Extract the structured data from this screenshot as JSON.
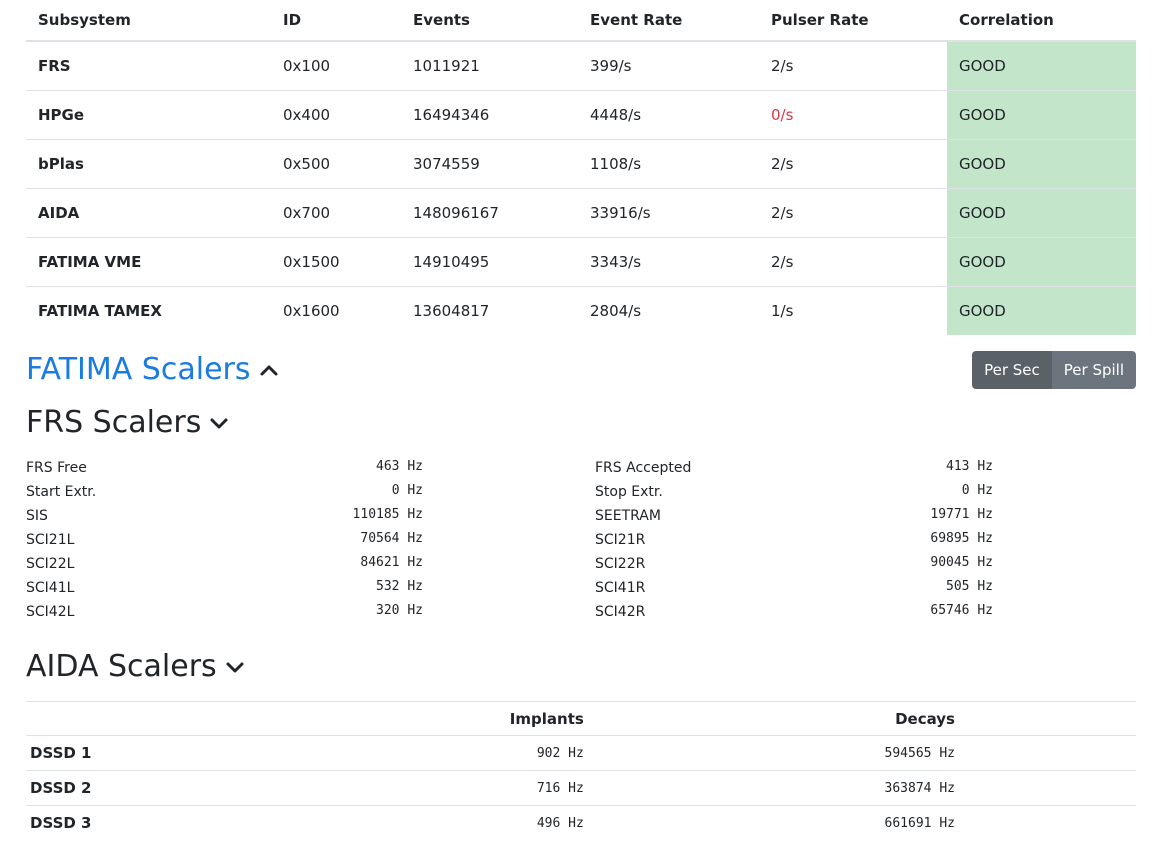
{
  "subsystems_table": {
    "headers": [
      "Subsystem",
      "ID",
      "Events",
      "Event Rate",
      "Pulser Rate",
      "Correlation"
    ],
    "rows": [
      {
        "name": "FRS",
        "id": "0x100",
        "events": "1011921",
        "event_rate": "399/s",
        "pulser_rate": "2/s",
        "correlation": "GOOD"
      },
      {
        "name": "HPGe",
        "id": "0x400",
        "events": "16494346",
        "event_rate": "4448/s",
        "pulser_rate": "0/s",
        "correlation": "GOOD"
      },
      {
        "name": "bPlas",
        "id": "0x500",
        "events": "3074559",
        "event_rate": "1108/s",
        "pulser_rate": "2/s",
        "correlation": "GOOD"
      },
      {
        "name": "AIDA",
        "id": "0x700",
        "events": "148096167",
        "event_rate": "33916/s",
        "pulser_rate": "2/s",
        "correlation": "GOOD"
      },
      {
        "name": "FATIMA VME",
        "id": "0x1500",
        "events": "14910495",
        "event_rate": "3343/s",
        "pulser_rate": "2/s",
        "correlation": "GOOD"
      },
      {
        "name": "FATIMA TAMEX",
        "id": "0x1600",
        "events": "13604817",
        "event_rate": "2804/s",
        "pulser_rate": "1/s",
        "correlation": "GOOD"
      }
    ]
  },
  "fatima_scalers": {
    "title": "FATIMA Scalers",
    "icon": "chevron-up-icon"
  },
  "rate_toggle": {
    "per_sec": "Per Sec",
    "per_spill": "Per Spill",
    "selected": "Per Sec"
  },
  "frs_scalers": {
    "title": "FRS Scalers",
    "icon": "chevron-down-icon",
    "rows": [
      {
        "left_label": "FRS Free",
        "left_value": "463 Hz",
        "right_label": "FRS Accepted",
        "right_value": "413 Hz"
      },
      {
        "left_label": "Start Extr.",
        "left_value": "0 Hz",
        "right_label": "Stop Extr.",
        "right_value": "0 Hz"
      },
      {
        "left_label": "SIS",
        "left_value": "110185 Hz",
        "right_label": "SEETRAM",
        "right_value": "19771 Hz"
      },
      {
        "left_label": "SCI21L",
        "left_value": "70564 Hz",
        "right_label": "SCI21R",
        "right_value": "69895 Hz"
      },
      {
        "left_label": "SCI22L",
        "left_value": "84621 Hz",
        "right_label": "SCI22R",
        "right_value": "90045 Hz"
      },
      {
        "left_label": "SCI41L",
        "left_value": "532 Hz",
        "right_label": "SCI41R",
        "right_value": "505 Hz"
      },
      {
        "left_label": "SCI42L",
        "left_value": "320 Hz",
        "right_label": "SCI42R",
        "right_value": "65746 Hz"
      }
    ]
  },
  "aida_scalers": {
    "title": "AIDA Scalers",
    "icon": "chevron-down-icon",
    "headers": {
      "implants": "Implants",
      "decays": "Decays"
    },
    "rows": [
      {
        "name": "DSSD 1",
        "implants": "902 Hz",
        "decays": "594565 Hz"
      },
      {
        "name": "DSSD 2",
        "implants": "716 Hz",
        "decays": "363874 Hz"
      },
      {
        "name": "DSSD 3",
        "implants": "496 Hz",
        "decays": "661691 Hz"
      }
    ]
  },
  "colors": {
    "good": "#c3e6cb",
    "bad_rate": "#dc3545",
    "link": "#1a7ce0"
  }
}
